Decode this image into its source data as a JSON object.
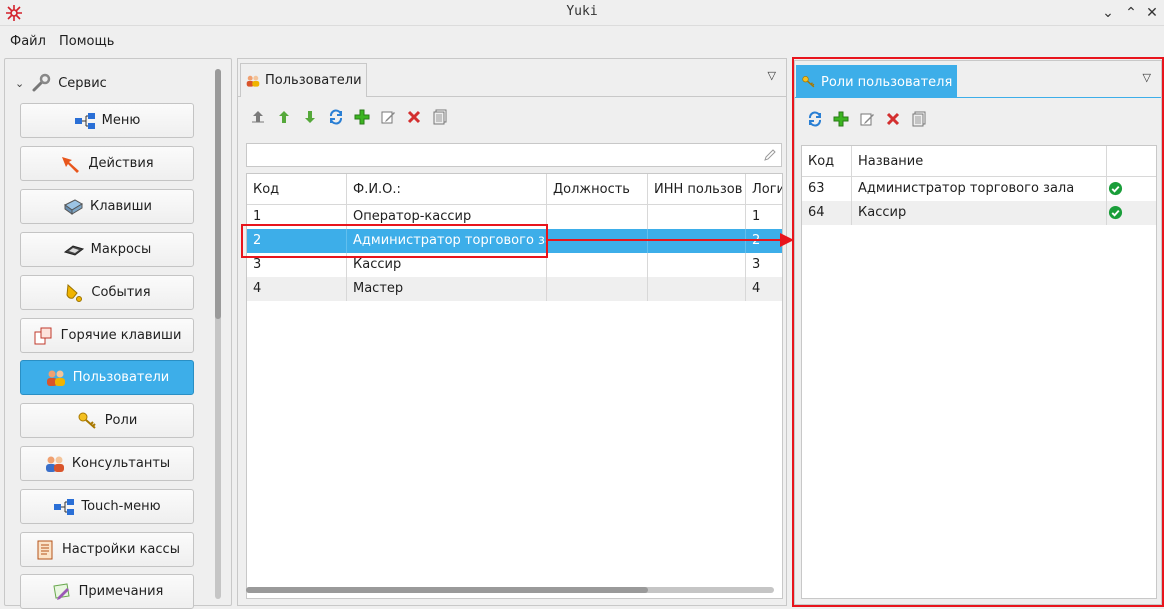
{
  "window": {
    "title": "Yuki"
  },
  "menubar": {
    "file": "Файл",
    "help": "Помощь"
  },
  "sidebar": {
    "root_label": "Сервис",
    "items": [
      {
        "label": "Меню",
        "icon": "menu-tree-icon"
      },
      {
        "label": "Действия",
        "icon": "actions-icon"
      },
      {
        "label": "Клавиши",
        "icon": "keyboard-icon"
      },
      {
        "label": "Макросы",
        "icon": "macro-icon"
      },
      {
        "label": "События",
        "icon": "bell-icon"
      },
      {
        "label": "Горячие клавиши",
        "icon": "hotkeys-icon"
      },
      {
        "label": "Пользователи",
        "icon": "users-icon",
        "active": true
      },
      {
        "label": "Роли",
        "icon": "key-icon"
      },
      {
        "label": "Консультанты",
        "icon": "consultants-icon"
      },
      {
        "label": "Touch-меню",
        "icon": "touch-menu-icon"
      },
      {
        "label": "Настройки кассы",
        "icon": "register-settings-icon"
      },
      {
        "label": "Примечания",
        "icon": "notes-icon"
      }
    ]
  },
  "users_panel": {
    "tab_label": "Пользователи",
    "columns": [
      "Код",
      "Ф.И.О.:",
      "Должность",
      "ИНН пользов",
      "Логи"
    ],
    "rows": [
      {
        "code": "1",
        "name": "Оператор-кассир",
        "position": "",
        "inn": "",
        "login": "1"
      },
      {
        "code": "2",
        "name": "Администратор торгового зала",
        "position": "",
        "inn": "",
        "login": "2"
      },
      {
        "code": "3",
        "name": "Кассир",
        "position": "",
        "inn": "",
        "login": "3"
      },
      {
        "code": "4",
        "name": "Мастер",
        "position": "",
        "inn": "",
        "login": "4"
      }
    ],
    "selected_row": "2"
  },
  "roles_panel": {
    "tab_label": "Роли пользователя",
    "columns": [
      "Код",
      "Название",
      ""
    ],
    "rows": [
      {
        "code": "63",
        "name": "Администратор торгового зала",
        "checked": true
      },
      {
        "code": "64",
        "name": "Кассир",
        "checked": true
      }
    ]
  },
  "colors": {
    "accent": "#3daee9",
    "highlight": "#e8141c",
    "check": "#1a9e3a"
  }
}
